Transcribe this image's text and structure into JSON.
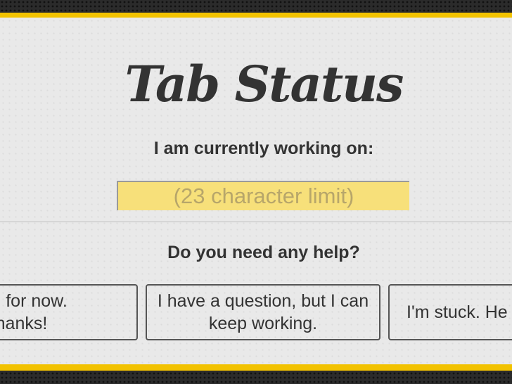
{
  "header": {
    "title": "Tab Status"
  },
  "status": {
    "label": "I am currently working on:",
    "input_value": "",
    "placeholder": "(23 character limit)"
  },
  "help": {
    "label": "Do you need any help?",
    "options": [
      {
        "label": "well for now.\nthanks!"
      },
      {
        "label": "I have a question, but I can keep working."
      },
      {
        "label": "I'm stuck. He"
      }
    ]
  },
  "colors": {
    "accent_yellow": "#f2c200",
    "input_background": "#f7e07a",
    "panel_background": "#e9e9e9",
    "text": "#333333",
    "frame_background": "#2b2b2b"
  }
}
